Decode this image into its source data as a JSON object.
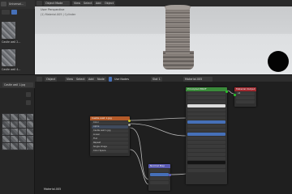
{
  "asset_browser": {
    "title": "Universal...",
    "items": [
      {
        "label": "Castle wall 2..."
      },
      {
        "label": "Castle wall 4..."
      }
    ]
  },
  "viewport": {
    "mode_label": "Object Mode",
    "menus": [
      "View",
      "Select",
      "Add",
      "Object"
    ],
    "perspective_label": "User Perspective",
    "object_info": "(1) Material.005 | Cylinder"
  },
  "node_editor": {
    "header_items": [
      "Object",
      "View",
      "Select",
      "Add",
      "Node"
    ],
    "use_nodes_label": "Use Nodes",
    "slot_label": "Slot 1",
    "material_name": "Material.005",
    "material_footer": "Material.005"
  },
  "image_panel": {
    "title": "Castle wall 1.jpg"
  },
  "nodes": {
    "bsdf": {
      "title": "Principled BSDF"
    },
    "output": {
      "title": "Material Output",
      "target": "All"
    },
    "image_texture": {
      "title": "Castle wall 1.jpg",
      "rows": [
        "Color",
        "Alpha",
        "Castle wall 1.jpg",
        "Linear",
        "Flat",
        "Repeat",
        "Single Image",
        "Color Space",
        "Alpha"
      ]
    },
    "normal_map": {
      "title": "Normal Map"
    }
  },
  "colors": {
    "shader_header": "#3a8a3a",
    "texture_header": "#b35a29",
    "vector_header": "#5a5ab0",
    "output_header": "#a02a30"
  }
}
